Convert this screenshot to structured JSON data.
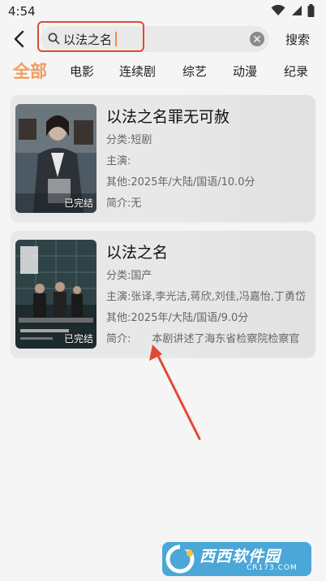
{
  "status": {
    "time": "4:54"
  },
  "search": {
    "value": "以法之名",
    "button": "搜索"
  },
  "tabs": [
    "全部",
    "电影",
    "连续剧",
    "综艺",
    "动漫",
    "纪录"
  ],
  "results": [
    {
      "title": "以法之名罪无可赦",
      "category_label": "分类:",
      "category": "短剧",
      "cast_label": "主演:",
      "cast": "",
      "other_label": "其他:",
      "other": "2025年/大陆/国语/10.0分",
      "intro_label": "简介:",
      "intro": "无",
      "status": "已完结"
    },
    {
      "title": "以法之名",
      "category_label": "分类:",
      "category": "国产",
      "cast_label": "主演:",
      "cast": "张译,李光洁,蒋欣,刘佳,冯嘉怡,丁勇岱",
      "other_label": "其他:",
      "other": "2025年/大陆/国语/9.0分",
      "intro_label": "简介:",
      "intro": "　　本剧讲述了海东省检察院检察官",
      "status": "已完结"
    }
  ],
  "watermark": {
    "brand": "西西软件园",
    "domain": "CR173.COM"
  },
  "colors": {
    "accent": "#f29b5e",
    "highlight": "#e04a33",
    "arrow": "#e04a33"
  }
}
